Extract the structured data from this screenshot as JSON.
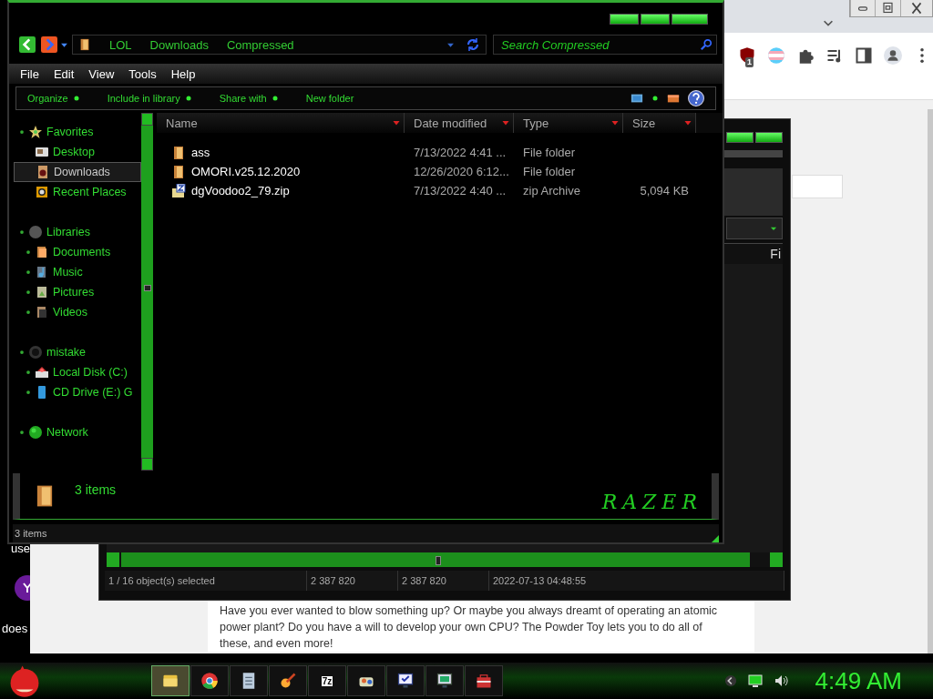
{
  "desktop": {
    "texts": [
      "use",
      "does"
    ]
  },
  "browser": {
    "extensions": [
      {
        "kind": "shield",
        "badge": "1"
      },
      {
        "kind": "flag"
      },
      {
        "kind": "puzzle"
      },
      {
        "kind": "media"
      },
      {
        "kind": "sidebar"
      },
      {
        "kind": "profile"
      },
      {
        "kind": "menu"
      }
    ],
    "paragraph": "Have you ever wanted to blow something up? Or maybe you always dreamt of operating an atomic power plant? Do you have a will to develop your own CPU? The Powder Toy lets you to do all of these, and even more!"
  },
  "archiver": {
    "column_header": "Fi",
    "status": [
      "1 / 16 object(s) selected",
      "2 387 820",
      "2 387 820",
      "2022-07-13 04:48:55"
    ]
  },
  "explorer": {
    "breadcrumbs": [
      "LOL",
      "Downloads",
      "Compressed"
    ],
    "search": {
      "placeholder": "Search Compressed"
    },
    "menu": [
      "File",
      "Edit",
      "View",
      "Tools",
      "Help"
    ],
    "commands": [
      "Organize",
      "Include in library",
      "Share with",
      "New folder"
    ],
    "nav": [
      {
        "label": "Favorites",
        "kind": "star",
        "selected": false,
        "children": [
          {
            "label": "Desktop",
            "kind": "desktop",
            "expander": false,
            "selected": false
          },
          {
            "label": "Downloads",
            "kind": "downloads",
            "expander": false,
            "selected": true
          },
          {
            "label": "Recent Places",
            "kind": "recent",
            "expander": false,
            "selected": false
          }
        ]
      },
      {
        "label": "Libraries",
        "kind": "library",
        "selected": false,
        "children": [
          {
            "label": "Documents",
            "kind": "documents",
            "expander": true,
            "selected": false
          },
          {
            "label": "Music",
            "kind": "music",
            "expander": true,
            "selected": false
          },
          {
            "label": "Pictures",
            "kind": "pictures",
            "expander": true,
            "selected": false
          },
          {
            "label": "Videos",
            "kind": "videos",
            "expander": true,
            "selected": false
          }
        ]
      },
      {
        "label": "mistake",
        "kind": "computer",
        "selected": false,
        "children": [
          {
            "label": "Local Disk (C:)",
            "kind": "disk",
            "expander": true,
            "selected": false
          },
          {
            "label": "CD Drive (E:) G",
            "kind": "cd",
            "expander": true,
            "selected": false
          }
        ]
      },
      {
        "label": "Network",
        "kind": "network",
        "selected": false
      }
    ],
    "columns": [
      "Name",
      "Date modified",
      "Type",
      "Size"
    ],
    "rows": [
      {
        "kind": "folder",
        "name": "ass",
        "date": "7/13/2022 4:41 ...",
        "type": "File folder",
        "selected": false
      },
      {
        "kind": "folder",
        "name": "OMORI.v25.12.2020",
        "date": "12/26/2020 6:12...",
        "type": "File folder",
        "selected": false
      },
      {
        "kind": "zip",
        "name": "dgVoodoo2_79.zip",
        "date": "7/13/2022 4:40 ...",
        "type": "zip Archive",
        "size": "5,094 KB",
        "selected": false
      }
    ],
    "details": {
      "count": "3 items",
      "logo": "RAZER"
    },
    "status": "3 items"
  },
  "taskbar": {
    "apps": [
      {
        "kind": "folder",
        "selected": true
      },
      {
        "kind": "chrome",
        "selected": false
      },
      {
        "kind": "notepad",
        "selected": false
      },
      {
        "kind": "brush",
        "selected": false
      },
      {
        "kind": "archive",
        "label": "7z",
        "selected": false
      },
      {
        "kind": "games",
        "selected": false
      },
      {
        "kind": "monitor-check",
        "selected": false
      },
      {
        "kind": "monitor",
        "selected": false
      },
      {
        "kind": "toolbox",
        "selected": false
      }
    ],
    "clock": "4:49 AM"
  }
}
